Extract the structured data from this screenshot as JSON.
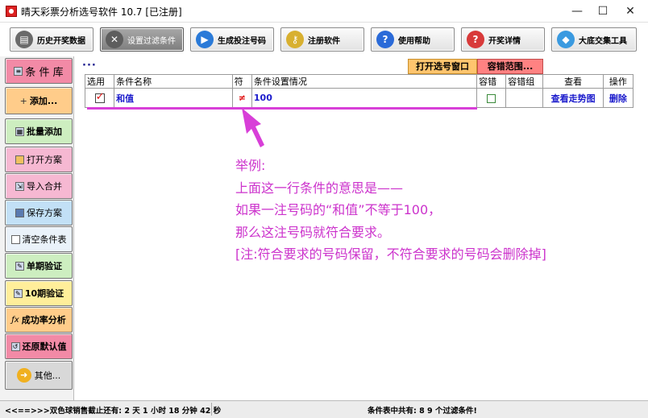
{
  "window": {
    "title": "晴天彩票分析选号软件 10.7  [已注册]",
    "minimize": "—",
    "maximize": "☐",
    "close": "✕"
  },
  "toolbar": [
    {
      "label": "历史开奖数据",
      "icon": "database-icon",
      "color": "#6a6a6a"
    },
    {
      "label": "设置过滤条件",
      "icon": "tools-icon",
      "color": "#8a8a8a"
    },
    {
      "label": "生成投注号码",
      "icon": "play-icon",
      "color": "#2a7ad8"
    },
    {
      "label": "注册软件",
      "icon": "key-icon",
      "color": "#d8b030"
    },
    {
      "label": "使用帮助",
      "icon": "help-icon",
      "color": "#2a6ad8"
    },
    {
      "label": "开奖详情",
      "icon": "question-icon",
      "color": "#d83a3a"
    },
    {
      "label": "大底交集工具",
      "icon": "cube-icon",
      "color": "#3a9ae0"
    }
  ],
  "sidebar": [
    {
      "label": "条 件 库",
      "icon": "list-icon",
      "color": "#f28aa6"
    },
    {
      "label": "添加...",
      "icon": "plus-icon",
      "color": "#ffcc8a"
    },
    {
      "label": "批量添加",
      "icon": "grid-icon",
      "color": "#cdeec0"
    },
    {
      "label": "打开方案",
      "icon": "folder-icon",
      "color": "#f6b8d2"
    },
    {
      "label": "导入合并",
      "icon": "import-icon",
      "color": "#f6b8d2"
    },
    {
      "label": "保存方案",
      "icon": "save-icon",
      "color": "#c2e0f6"
    },
    {
      "label": "清空条件表",
      "icon": "clear-icon",
      "color": "#eaf2fa"
    },
    {
      "label": "单期验证",
      "icon": "check-icon",
      "color": "#cdeec0"
    },
    {
      "label": "10期验证",
      "icon": "check-icon",
      "color": "#ffee9a"
    },
    {
      "label": "成功率分析",
      "icon": "function-icon",
      "color": "#ffcc8a"
    },
    {
      "label": "还原默认值",
      "icon": "restore-icon",
      "color": "#f28aa6"
    },
    {
      "label": "其他...",
      "icon": "arrow-right-icon",
      "color": "#d8d8d8"
    }
  ],
  "main": {
    "dots": "···",
    "open_window": "打开选号窗口",
    "tolerance_range": "容错范围..."
  },
  "table": {
    "headers": [
      "选用",
      "条件名称",
      "符",
      "条件设置情况",
      "容错",
      "容错组",
      "查看",
      "操作"
    ],
    "rows": [
      {
        "checked": true,
        "name": "和值",
        "symbol": "≠",
        "setting": "100",
        "tolerance": false,
        "group": "",
        "view": "查看走势图",
        "action": "删除"
      }
    ]
  },
  "note": {
    "line1": "举例:",
    "line2": "上面这一行条件的意思是——",
    "line3": "如果一注号码的“和值”不等于100，",
    "line4": "那么这注号码就符合要求。",
    "line5": "[注:符合要求的号码保留，不符合要求的号码会删除掉]"
  },
  "status": {
    "left": "<<==>>>双色球销售截止还有: 2 天 1 小时 18 分钟 42 秒",
    "right": "条件表中共有: 8 9 个过滤条件!"
  },
  "accent": "#d83fd8"
}
